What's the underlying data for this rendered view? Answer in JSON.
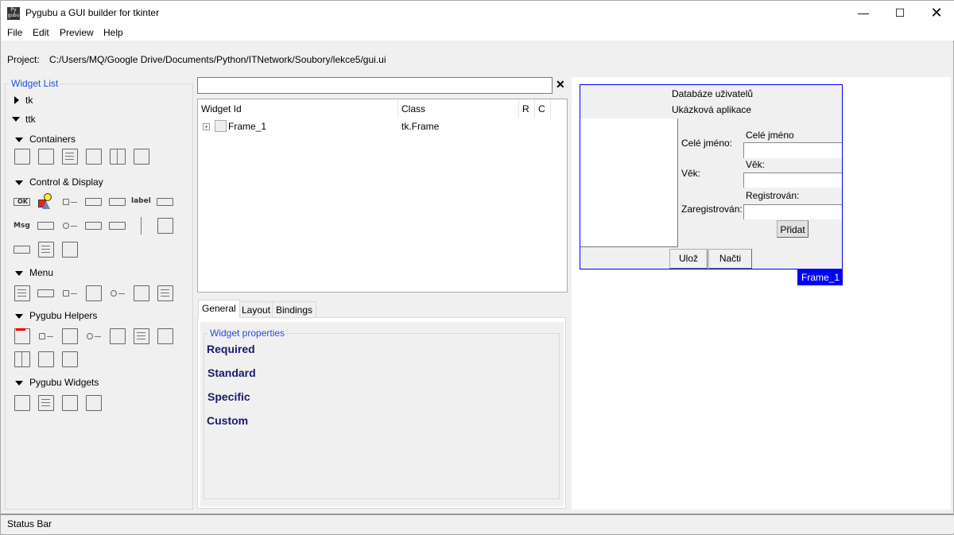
{
  "window": {
    "title": "Pygubu a GUI builder for tkinter",
    "icon_text": "Py gubu",
    "controls": [
      "minimize",
      "maximize",
      "close"
    ]
  },
  "menu": [
    "File",
    "Edit",
    "Preview",
    "Help"
  ],
  "project": {
    "label": "Project:",
    "path": "C:/Users/MQ/Google Drive/Documents/Python/ITNetwork/Soubory/lekce5/gui.ui"
  },
  "widget_list": {
    "title": "Widget List",
    "tk": "tk",
    "ttk": "ttk",
    "groups": [
      {
        "label": "Containers",
        "icons": [
          "frame",
          "labelframe",
          "scrollbar-frame",
          "notebook",
          "panedwindow",
          "toplevel-frame"
        ]
      },
      {
        "label": "Control & Display",
        "icons": [
          "button",
          "label-image",
          "checkbutton",
          "combobox",
          "entry",
          "label",
          "menubutton",
          "message",
          "progressbar",
          "radiobutton",
          "scale",
          "scrollbar",
          "separator",
          "sizegrip",
          "spinbox",
          "text",
          "treeview"
        ],
        "label_text": "label",
        "button_text": "OK",
        "message_text": "Msg"
      },
      {
        "label": "Menu",
        "icons": [
          "menu",
          "submenu",
          "checkbutton-item",
          "command-item",
          "radiobutton-item",
          "separator-item",
          "menu-list"
        ]
      },
      {
        "label": "Pygubu Helpers",
        "icons": [
          "toplevel",
          "checkbutton-var",
          "command",
          "radiobutton-var",
          "separator",
          "listbox",
          "folder",
          "paned",
          "scrolled-frame",
          "tree-frame"
        ]
      },
      {
        "label": "Pygubu Widgets",
        "icons": [
          "window",
          "text-frame",
          "canvas",
          "scrollable"
        ]
      }
    ]
  },
  "search": {
    "value": "",
    "clear": "✕"
  },
  "tree": {
    "columns": [
      "Widget Id",
      "Class",
      "R",
      "C"
    ],
    "rows": [
      {
        "id": "Frame_1",
        "class": "tk.Frame",
        "expander": "+"
      }
    ]
  },
  "tabs": [
    "General",
    "Layout",
    "Bindings"
  ],
  "properties": {
    "title": "Widget properties",
    "sections": [
      "Required",
      "Standard",
      "Specific",
      "Custom"
    ]
  },
  "preview": {
    "title": "Databáze uživatelů",
    "subtitle": "Ukázková aplikace",
    "fields": [
      {
        "label": "Celé jméno:",
        "caption": "Celé jméno",
        "value": ""
      },
      {
        "label": "Věk:",
        "caption": "Věk:",
        "value": ""
      },
      {
        "label": "Zaregistrován:",
        "caption": "Registrován:",
        "value": ""
      }
    ],
    "add_button": "Přidat",
    "save_button": "Ulož",
    "load_button": "Načti",
    "frame_badge": "Frame_1",
    "selection_color": "#0000ff"
  },
  "status": "Status Bar"
}
